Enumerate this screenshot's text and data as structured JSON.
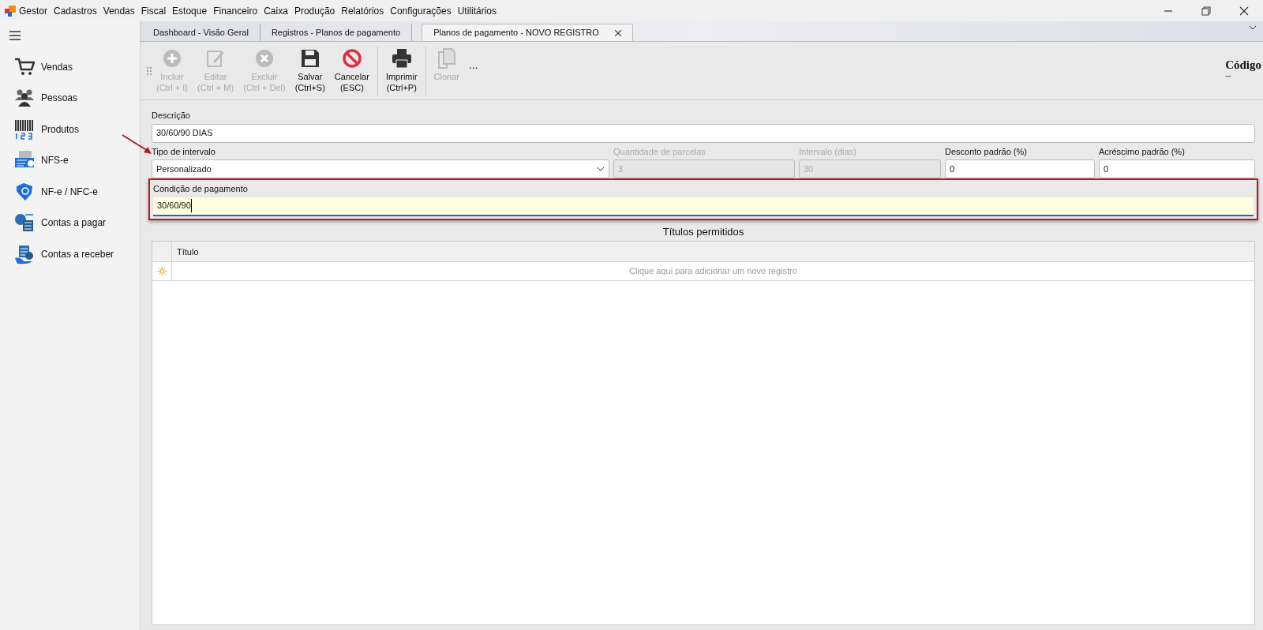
{
  "menu": {
    "app": "Gestor",
    "items": [
      "Cadastros",
      "Vendas",
      "Fiscal",
      "Estoque",
      "Financeiro",
      "Caixa",
      "Produção",
      "Relatórios",
      "Configurações",
      "Utilitários"
    ]
  },
  "sidebar": {
    "items": [
      {
        "kind": "cart",
        "label": "Vendas"
      },
      {
        "kind": "people",
        "label": "Pessoas"
      },
      {
        "kind": "barcode",
        "label": "Produtos"
      },
      {
        "kind": "nfse",
        "label": "NFS-e"
      },
      {
        "kind": "nfe",
        "label": "NF-e / NFC-e"
      },
      {
        "kind": "payable",
        "label": "Contas a pagar"
      },
      {
        "kind": "receivable",
        "label": "Contas a receber"
      }
    ]
  },
  "tabs": [
    {
      "label": "Dashboard - Visão Geral",
      "selected": false,
      "closable": false
    },
    {
      "label": "Registros - Planos de pagamento",
      "selected": false,
      "closable": false
    },
    {
      "label": "Planos de pagamento - NOVO REGISTRO",
      "selected": true,
      "closable": true
    }
  ],
  "toolbar": {
    "buttons": [
      {
        "kind": "add",
        "label": "Incluir",
        "shortcut": "(Ctrl + I)",
        "disabled": true
      },
      {
        "kind": "edit",
        "label": "Editar",
        "shortcut": "(Ctrl + M)",
        "disabled": true
      },
      {
        "kind": "delete",
        "label": "Excluir",
        "shortcut": "(Ctrl + Del)",
        "disabled": true
      },
      {
        "kind": "save",
        "label": "Salvar",
        "shortcut": "(Ctrl+S)",
        "disabled": false
      },
      {
        "kind": "cancel",
        "label": "Cancelar",
        "shortcut": "(ESC)",
        "disabled": false
      },
      {
        "kind": "print",
        "label": "Imprimir",
        "shortcut": "(Ctrl+P)",
        "disabled": false
      },
      {
        "kind": "clone",
        "label": "Clonar",
        "disabled": true
      }
    ],
    "more": "...",
    "code_label": "Código",
    "code_value": "--"
  },
  "form": {
    "descricao": {
      "label": "Descrição",
      "value": "30/60/90 DIAS"
    },
    "row": [
      {
        "kind": "select",
        "label": "Tipo de intervalo",
        "value": "Personalizado",
        "disabled": false
      },
      {
        "kind": "text",
        "label": "Quantidade de parcelas",
        "value": "3",
        "disabled": true
      },
      {
        "kind": "text",
        "label": "Intervalo (dias)",
        "value": "30",
        "disabled": true
      },
      {
        "kind": "text",
        "label": "Desconto padrão (%)",
        "value": "0",
        "disabled": false
      },
      {
        "kind": "text",
        "label": "Acréscimo padrão (%)",
        "value": "0",
        "disabled": false
      }
    ],
    "condicao": {
      "label": "Condição de pagamento",
      "value": "30/60/90",
      "focused": true,
      "highlighted": true
    }
  },
  "grid": {
    "title": "Títulos permitidos",
    "columns": [
      "Título"
    ],
    "new_row_hint": "Clique aqui para adicionar um novo registro"
  }
}
